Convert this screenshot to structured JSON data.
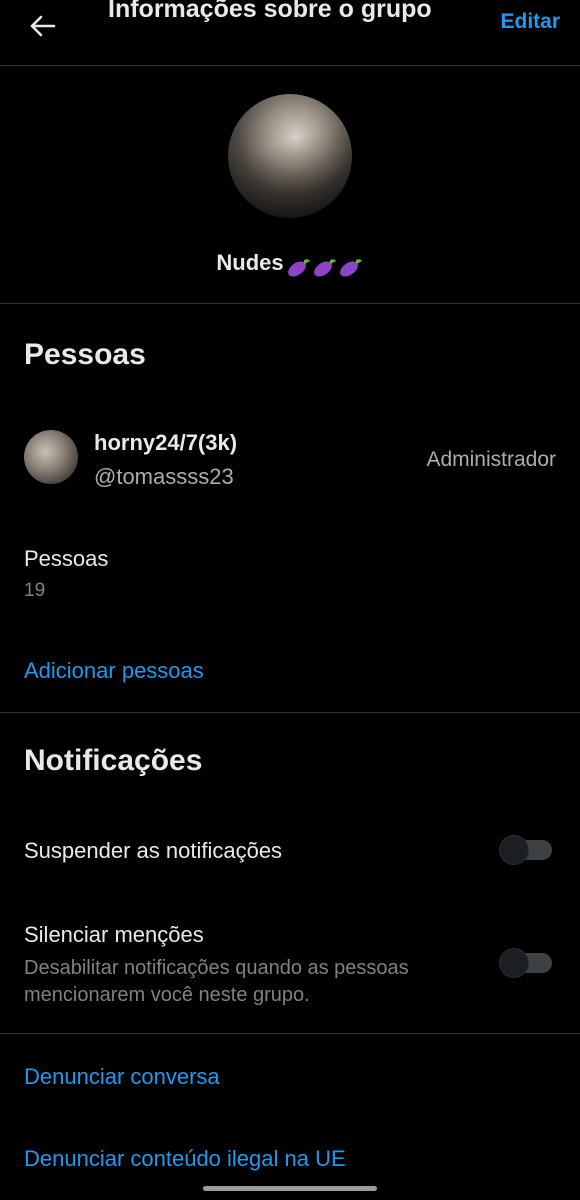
{
  "header": {
    "title": "Informações sobre o grupo",
    "edit_label": "Editar"
  },
  "group": {
    "name": "Nudes",
    "emoji_icons": [
      "eggplant-icon",
      "eggplant-icon",
      "eggplant-icon"
    ]
  },
  "people_section": {
    "title": "Pessoas",
    "members": [
      {
        "name": "horny24/7(3k)",
        "handle": "@tomassss23",
        "role": "Administrador"
      }
    ],
    "count_label": "Pessoas",
    "count_value": "19",
    "add_label": "Adicionar pessoas"
  },
  "notifications_section": {
    "title": "Notificações",
    "snooze_label": "Suspender as notificações",
    "snooze_enabled": false,
    "mute_mentions_label": "Silenciar menções",
    "mute_mentions_desc": "Desabilitar notificações quando as pessoas mencionarem você neste grupo.",
    "mute_mentions_enabled": false
  },
  "actions": {
    "report_conversation": "Denunciar conversa",
    "report_illegal_eu": "Denunciar conteúdo ilegal na UE"
  },
  "colors": {
    "background": "#000000",
    "accent": "#1d9bf0",
    "text_primary": "#e7e9ea",
    "text_secondary": "#7d8287",
    "divider": "#2f3336"
  }
}
